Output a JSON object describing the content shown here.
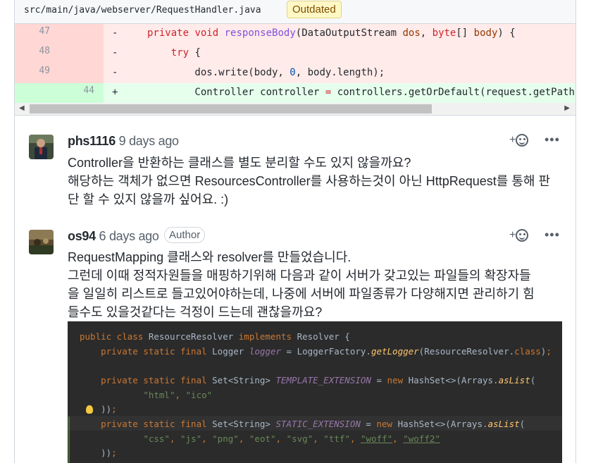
{
  "file": {
    "path": "src/main/java/webserver/RequestHandler.java",
    "badge": "Outdated"
  },
  "diff": {
    "lines": [
      {
        "old": "47",
        "new": "",
        "sign": "-",
        "type": "del"
      },
      {
        "old": "48",
        "new": "",
        "sign": "-",
        "type": "del"
      },
      {
        "old": "49",
        "new": "",
        "sign": "-",
        "type": "del"
      },
      {
        "old": "",
        "new": "44",
        "sign": "+",
        "type": "add"
      }
    ]
  },
  "comments": [
    {
      "author": "phs1116",
      "time": "9 days ago",
      "badge": "",
      "lines": [
        "Controller을 반환하는 클래스를 별도 분리할 수도 있지 않을까요?",
        "해당하는 객체가 없으면 ResourcesController를 사용하는것이 아닌 HttpRequest를 통해 판",
        "단 할 수 있지 않을까 싶어요. :)"
      ]
    },
    {
      "author": "os94",
      "time": "6 days ago",
      "badge": "Author",
      "lines": [
        "RequestMapping 클래스와 resolver를 만들었습니다.",
        "그런데 이때 정적자원들을 매핑하기위해 다음과 같이 서버가 갖고있는 파일들의 확장자들",
        "을 일일히 리스트로 들고있어야하는데, 나중에 서버에 파일종류가 다양해지면 관리하기 힘",
        "들수도 있을것같다는 걱정이 드는데 괜찮을까요?"
      ]
    }
  ],
  "actions": {
    "add_reaction": "+",
    "more": "•••"
  },
  "colors": {
    "deleted_bg": "#ffebe9",
    "added_bg": "#e6ffec",
    "badge_bg": "#fff8c5"
  }
}
